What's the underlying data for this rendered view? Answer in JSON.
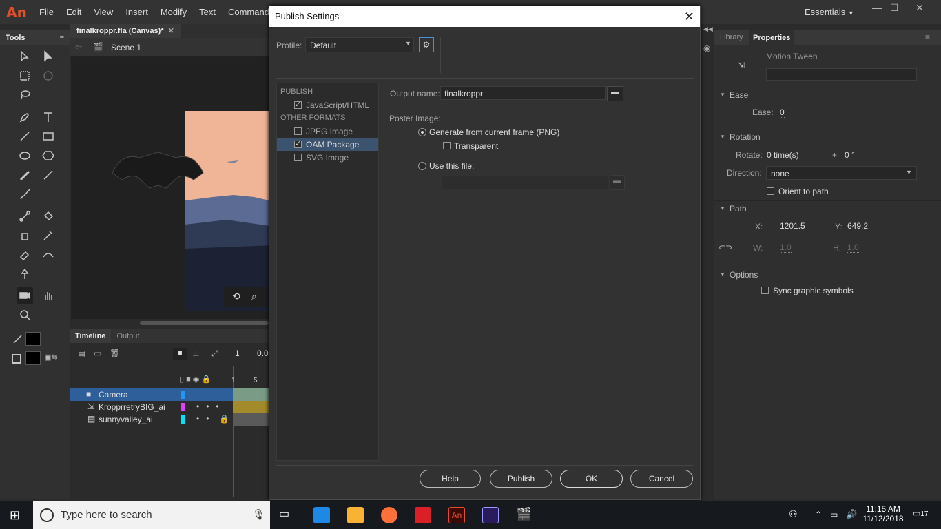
{
  "app": {
    "logo": "An",
    "menus": [
      "File",
      "Edit",
      "View",
      "Insert",
      "Modify",
      "Text",
      "Commands"
    ],
    "workspace": "Essentials",
    "win_min": "—",
    "win_max": "☐",
    "win_close": "✕"
  },
  "tools": {
    "title": "Tools"
  },
  "document": {
    "tab": "finalkroppr.fla (Canvas)*",
    "tab_close": "✕",
    "scene": "Scene 1"
  },
  "timeline": {
    "tabs": [
      "Timeline",
      "Output"
    ],
    "frame_num": "1",
    "fps": "0.0",
    "ruler": [
      "1",
      "5"
    ],
    "layers": [
      {
        "name": "Camera",
        "color": "#2196f3"
      },
      {
        "name": "KropprretryBIG_ai",
        "color": "#e040fb"
      },
      {
        "name": "sunnyvalley_ai",
        "color": "#00e5ff"
      }
    ]
  },
  "dialog": {
    "title": "Publish Settings",
    "close": "✕",
    "profile_label": "Profile:",
    "profile_value": "Default",
    "publish_header": "PUBLISH",
    "other_formats_header": "OTHER FORMATS",
    "formats": [
      {
        "label": "JavaScript/HTML",
        "checked": true
      },
      {
        "label": "JPEG Image",
        "checked": false
      },
      {
        "label": "OAM Package",
        "checked": true
      },
      {
        "label": "SVG Image",
        "checked": false
      }
    ],
    "output_name_label": "Output name:",
    "output_name_value": "finalkroppr",
    "poster_label": "Poster Image:",
    "opt_generate": "Generate from current frame (PNG)",
    "opt_transparent": "Transparent",
    "opt_use_file": "Use this file:",
    "buttons": {
      "help": "Help",
      "publish": "Publish",
      "ok": "OK",
      "cancel": "Cancel"
    }
  },
  "properties": {
    "tabs": [
      "Library",
      "Properties"
    ],
    "type": "Motion Tween",
    "ease": {
      "header": "Ease",
      "label": "Ease:",
      "value": "0"
    },
    "rotation": {
      "header": "Rotation",
      "rotate_label": "Rotate:",
      "rotate_value": "0 time(s)",
      "plus": "+",
      "deg": "0 °",
      "direction_label": "Direction:",
      "direction_value": "none",
      "orient": "Orient to path"
    },
    "path": {
      "header": "Path",
      "x_label": "X:",
      "x_value": "1201.5",
      "y_label": "Y:",
      "y_value": "649.2",
      "w_label": "W:",
      "w_value": "1.0",
      "h_label": "H:",
      "h_value": "1.0"
    },
    "options": {
      "header": "Options",
      "sync": "Sync graphic symbols"
    }
  },
  "taskbar": {
    "search_placeholder": "Type here to search",
    "time": "11:15 AM",
    "date": "11/12/2018",
    "notif": "17"
  }
}
